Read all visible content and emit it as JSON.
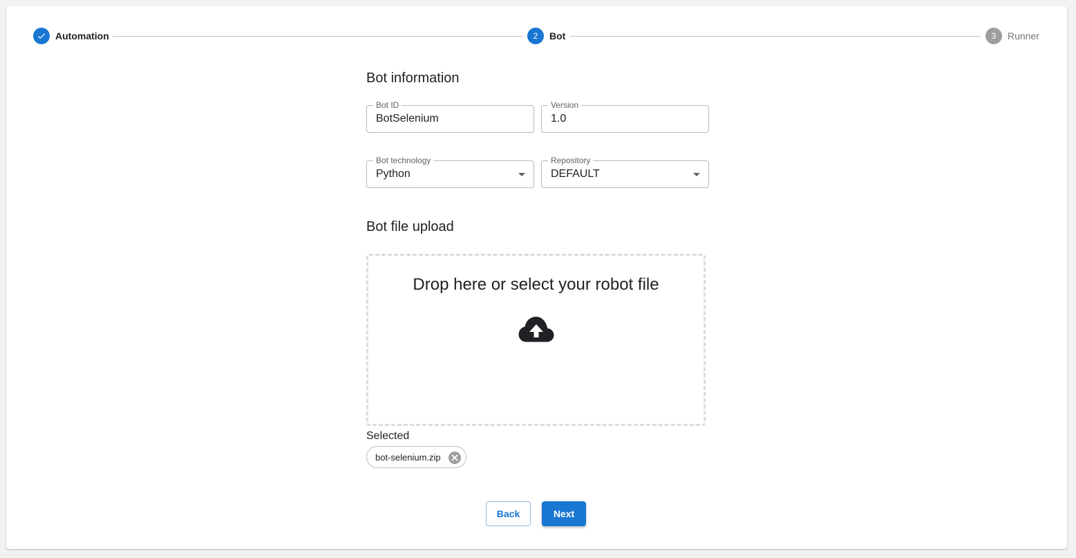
{
  "stepper": {
    "steps": [
      {
        "label": "Automation",
        "number": "1",
        "state": "completed"
      },
      {
        "label": "Bot",
        "number": "2",
        "state": "active"
      },
      {
        "label": "Runner",
        "number": "3",
        "state": "inactive"
      }
    ]
  },
  "bot_info": {
    "title": "Bot information",
    "bot_id": {
      "label": "Bot ID",
      "value": "BotSelenium"
    },
    "version": {
      "label": "Version",
      "value": "1.0"
    },
    "technology": {
      "label": "Bot technology",
      "value": "Python"
    },
    "repository": {
      "label": "Repository",
      "value": "DEFAULT"
    }
  },
  "upload": {
    "title": "Bot file upload",
    "dropzone_text": "Drop here or select your robot file",
    "selected_label": "Selected",
    "selected_file": "bot-selenium.zip"
  },
  "actions": {
    "back_label": "Back",
    "next_label": "Next"
  },
  "colors": {
    "primary": "#1976d2",
    "inactive_step": "#9e9e9e"
  }
}
